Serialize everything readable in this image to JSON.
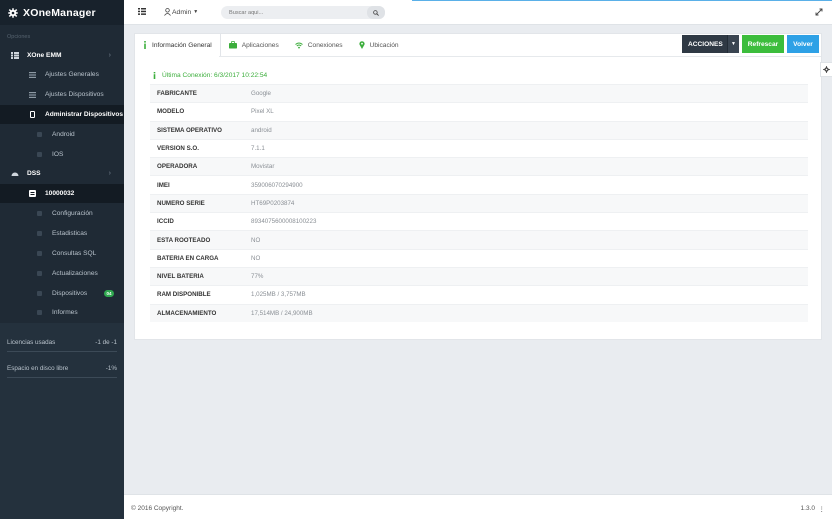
{
  "app": {
    "brand": "XOneManager"
  },
  "sidebar": {
    "section_label": "Opciones",
    "items": [
      {
        "label": "XOne EMM",
        "icon": "grid-icon"
      },
      {
        "label": "Ajustes Generales",
        "icon": "list-icon"
      },
      {
        "label": "Ajustes Dispositivos",
        "icon": "list-icon"
      },
      {
        "label": "Administrar Dispositivos",
        "icon": "mobile-icon"
      },
      {
        "label": "Android",
        "icon": "android-icon"
      },
      {
        "label": "IOS",
        "icon": "apple-icon"
      },
      {
        "label": "DSS",
        "icon": "dashboard-icon"
      },
      {
        "label": "10000032",
        "icon": "server-icon"
      },
      {
        "label": "Configuración",
        "icon": "wrench-icon"
      },
      {
        "label": "Estadisticas",
        "icon": "chart-icon"
      },
      {
        "label": "Consultas SQL",
        "icon": "sql-icon"
      },
      {
        "label": "Actualizaciones",
        "icon": "download-icon"
      },
      {
        "label": "Dispositivos",
        "icon": "devices-icon",
        "badge": "04"
      },
      {
        "label": "Informes",
        "icon": "report-icon"
      }
    ],
    "stats": [
      {
        "label": "Licencias usadas",
        "value": "-1 de -1"
      },
      {
        "label": "Espacio en disco libre",
        "value": "-1%"
      }
    ]
  },
  "topbar": {
    "user": "Admin",
    "search_placeholder": "Buscar aqui..."
  },
  "tabs": [
    {
      "label": "Información General",
      "icon": "info-icon"
    },
    {
      "label": "Aplicaciones",
      "icon": "briefcase-icon"
    },
    {
      "label": "Conexiones",
      "icon": "wifi-icon"
    },
    {
      "label": "Ubicación",
      "icon": "map-marker-icon"
    }
  ],
  "actions": {
    "acciones": "ACCIONES",
    "refrescar": "Refrescar",
    "volver": "Volver"
  },
  "last_connection": "Última Conexión: 6/3/2017 10:22:54",
  "device_info": [
    {
      "key": "FABRICANTE",
      "value": "Google"
    },
    {
      "key": "MODELO",
      "value": "Pixel XL"
    },
    {
      "key": "SISTEMA OPERATIVO",
      "value": "android"
    },
    {
      "key": "VERSION S.O.",
      "value": "7.1.1"
    },
    {
      "key": "OPERADORA",
      "value": "Movistar"
    },
    {
      "key": "IMEI",
      "value": "359006070294900"
    },
    {
      "key": "NUMERO SERIE",
      "value": "HT69P0203874"
    },
    {
      "key": "ICCID",
      "value": "8934075600008100223"
    },
    {
      "key": "ESTA ROOTEADO",
      "value": "NO"
    },
    {
      "key": "BATERIA EN CARGA",
      "value": "NO"
    },
    {
      "key": "NIVEL BATERIA",
      "value": "77%"
    },
    {
      "key": "RAM DISPONIBLE",
      "value": "1,025MB / 3,757MB"
    },
    {
      "key": "ALMACENAMIENTO",
      "value": "17,514MB / 24,900MB"
    }
  ],
  "footer": {
    "copyright": "© 2016 Copyright.",
    "version": "1.3.0"
  },
  "colors": {
    "sidebar_bg": "#1f2a35",
    "accent_green": "#3cbd3c",
    "accent_blue": "#2ea1e6",
    "dark_button": "#2f3944"
  }
}
